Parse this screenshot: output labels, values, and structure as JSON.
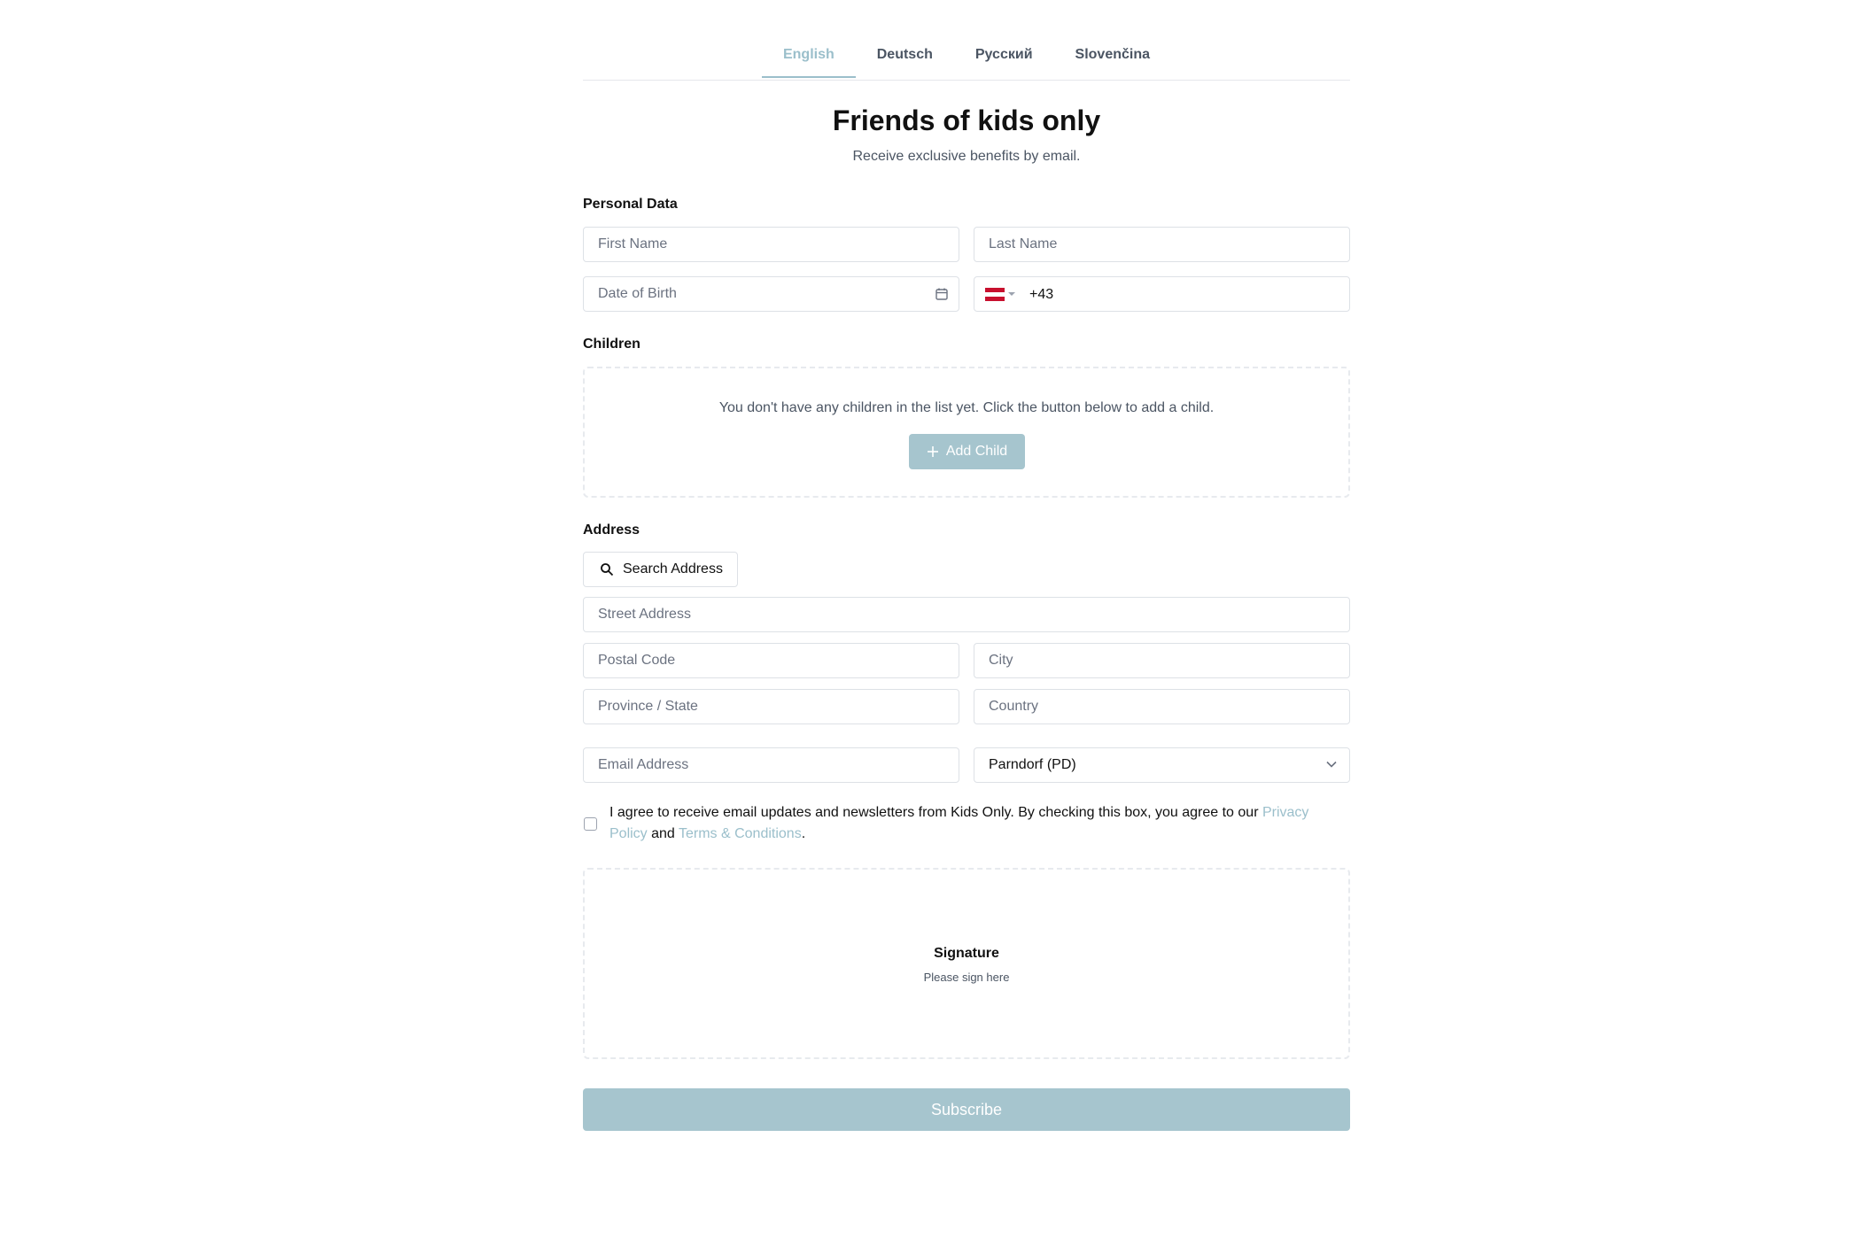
{
  "tabs": [
    {
      "label": "English",
      "active": true
    },
    {
      "label": "Deutsch",
      "active": false
    },
    {
      "label": "Русский",
      "active": false
    },
    {
      "label": "Slovenčina",
      "active": false
    }
  ],
  "header": {
    "title": "Friends of kids only",
    "subtitle": "Receive exclusive benefits by email."
  },
  "personal": {
    "label": "Personal Data",
    "first_name_placeholder": "First Name",
    "last_name_placeholder": "Last Name",
    "dob_placeholder": "Date of Birth",
    "phone_country": "Austria",
    "phone_value": "+43"
  },
  "children": {
    "label": "Children",
    "empty_message": "You don't have any children in the list yet. Click the button below to add a child.",
    "add_label": "Add Child"
  },
  "address": {
    "label": "Address",
    "search_label": "Search Address",
    "street_placeholder": "Street Address",
    "postal_placeholder": "Postal Code",
    "city_placeholder": "City",
    "province_placeholder": "Province / State",
    "country_placeholder": "Country"
  },
  "email_placeholder": "Email Address",
  "store_select": {
    "value": "Parndorf (PD)"
  },
  "consent": {
    "text_before": "I agree to receive email updates and newsletters from Kids Only. By checking this box, you agree to our ",
    "privacy_link": "Privacy Policy",
    "text_middle": " and ",
    "terms_link": "Terms & Conditions",
    "text_after": ".",
    "checked": false
  },
  "signature": {
    "title": "Signature",
    "hint": "Please sign here"
  },
  "submit_label": "Subscribe",
  "colors": {
    "accent": "#9bbfcb",
    "button": "#a6c5ce",
    "border": "#dde1e6",
    "muted_text": "#4b5563"
  }
}
